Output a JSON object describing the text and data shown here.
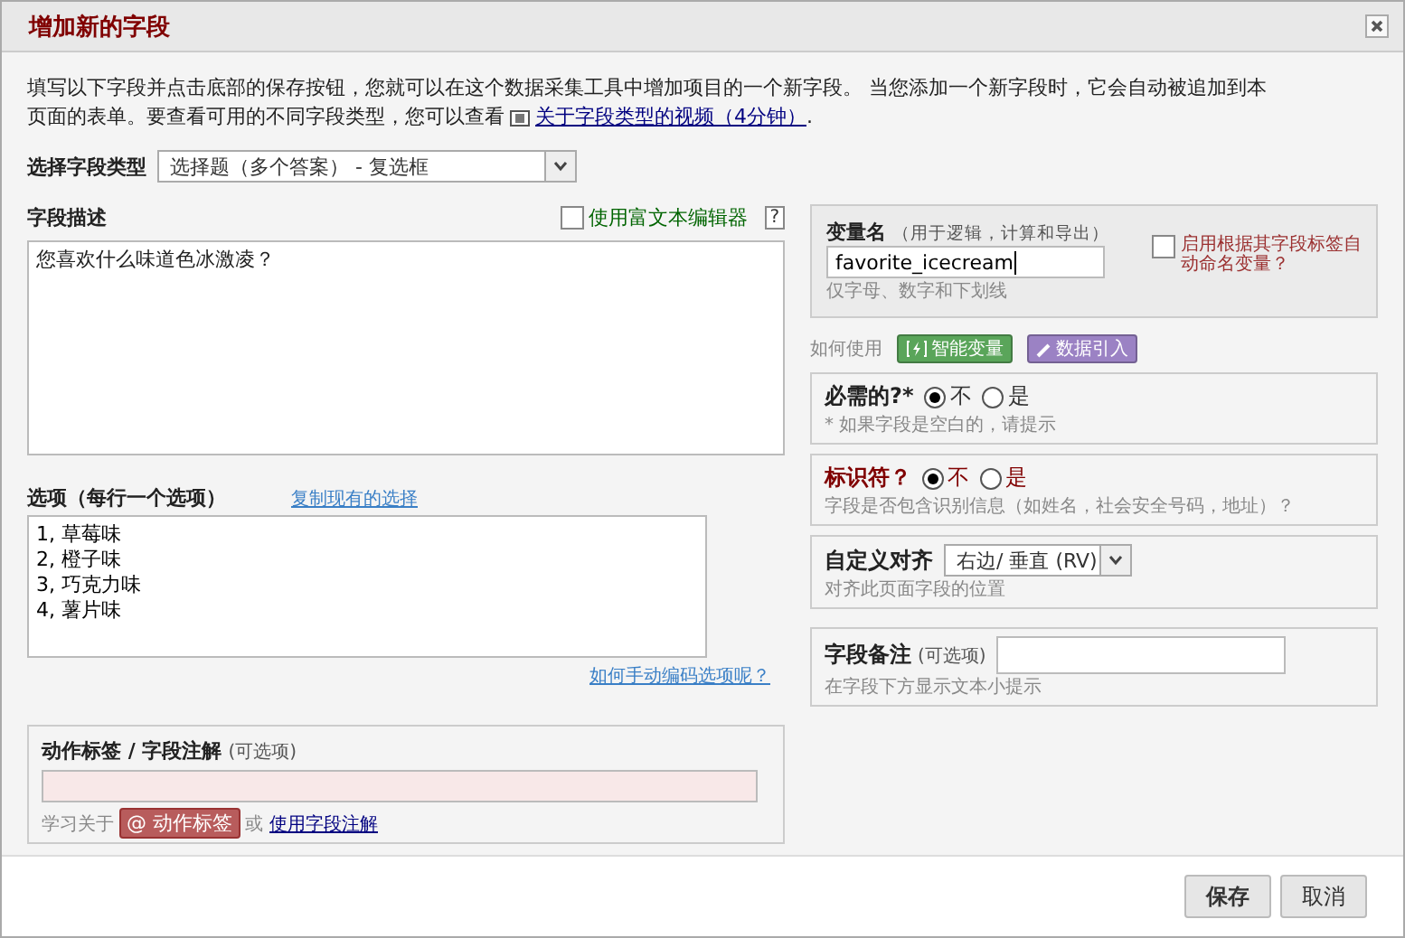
{
  "window": {
    "title": "增加新的字段"
  },
  "intro": {
    "text": "填写以下字段并点击底部的保存按钮，您就可以在这个数据采集工具中增加项目的一个新字段。 当您添加一个新字段时，它会自动被追加到本页面的表单。要查看可用的不同字段类型，您可以查看",
    "link": "关于字段类型的视频（4分钟）",
    "end": "."
  },
  "field_type": {
    "label": "选择字段类型",
    "value": "选择题（多个答案） - 复选框"
  },
  "description": {
    "label": "字段描述",
    "value": "您喜欢什么味道色冰激凌？",
    "rich_text": {
      "label": "使用富文本编辑器",
      "checked": false
    },
    "help": "?"
  },
  "choices": {
    "label": "选项（每行一个选项）",
    "copy_link": "复制现有的选择",
    "lines": [
      "1, 草莓味",
      "2, 橙子味",
      "3, 巧克力味",
      "4, 薯片味"
    ],
    "help_link": "如何手动编码选项呢？"
  },
  "action_tags": {
    "label": "动作标签 / 字段注解",
    "optional": "(可选项)",
    "learn": "学习关于",
    "tag": "@ 动作标签",
    "or": "或",
    "link": "使用字段注解"
  },
  "variable": {
    "label": "变量名",
    "hint": "（用于逻辑，计算和导出）",
    "value": "favorite_icecream",
    "note": "仅字母、数字和下划线",
    "auto_name": {
      "label": "启用根据其字段标签自动命名变量？",
      "checked": false
    }
  },
  "how_to_use": {
    "label": "如何使用",
    "buttons": [
      {
        "label": "智能变量",
        "kind": "smart",
        "color": "#5aa55a"
      },
      {
        "label": "数据引入",
        "kind": "piping",
        "color": "#9b82c4"
      }
    ]
  },
  "required": {
    "label": "必需的?*",
    "options": [
      {
        "label": "不",
        "selected": true
      },
      {
        "label": "是",
        "selected": false
      }
    ],
    "note": "* 如果字段是空白的，请提示"
  },
  "identifier": {
    "label": "标识符？",
    "options": [
      {
        "label": "不",
        "selected": true
      },
      {
        "label": "是",
        "selected": false
      }
    ],
    "note": "字段是否包含识别信息（如姓名，社会安全号码，地址）？"
  },
  "alignment": {
    "label": "自定义对齐",
    "value": "右边/ 垂直 (RV)",
    "note": "对齐此页面字段的位置"
  },
  "field_note": {
    "label": "字段备注",
    "optional": "(可选项)",
    "note": "在字段下方显示文本小提示"
  },
  "buttons": [
    {
      "label": "保存",
      "kind": "primary"
    },
    {
      "label": "取消",
      "kind": "secondary"
    }
  ]
}
